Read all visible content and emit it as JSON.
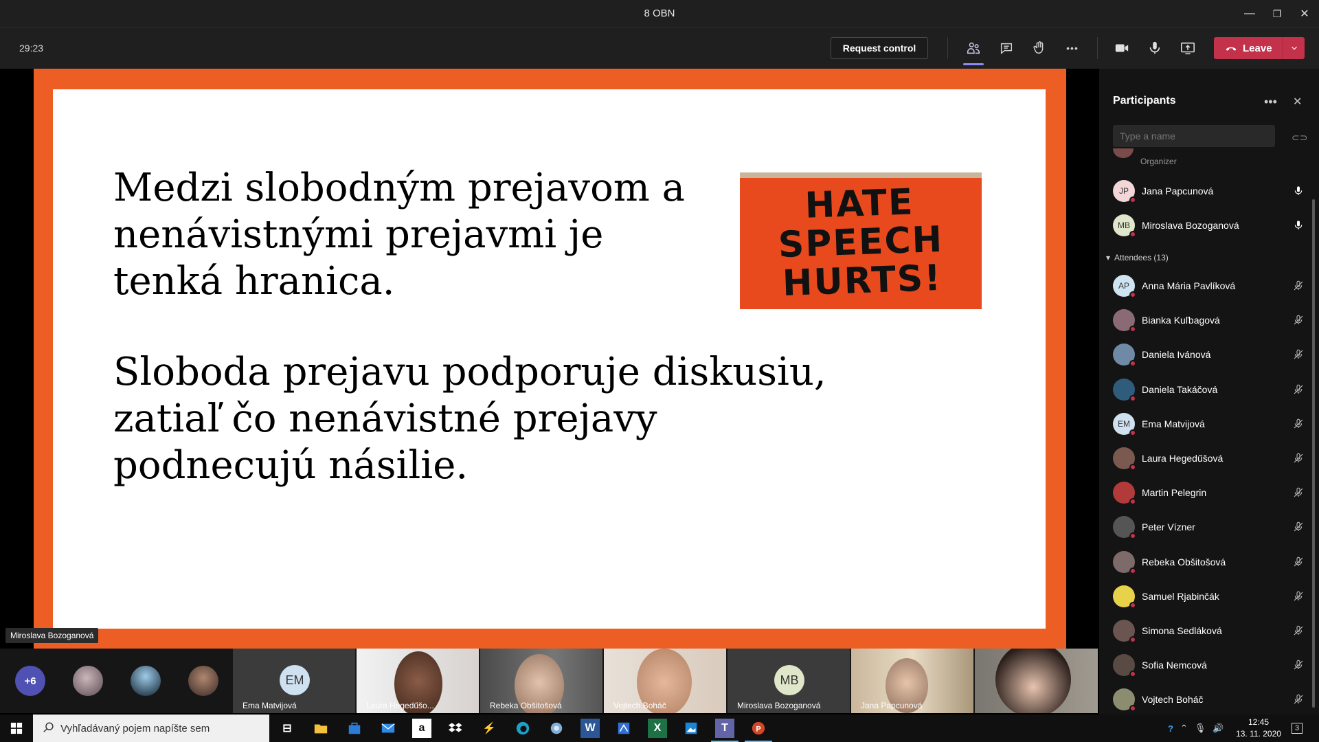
{
  "window": {
    "title": "8 OBN",
    "minimize": "—",
    "restore": "❐",
    "close": "✕"
  },
  "toolbar": {
    "timer": "29:23",
    "request_control": "Request control",
    "leave": "Leave",
    "more": "•••"
  },
  "slide": {
    "paragraph1": "Medzi slobodným prejavom a nenávistnými prejavmi je tenká hranica.",
    "paragraph2": "Sloboda prejavu podporuje diskusiu, zatiaľ čo nenávistné prejavy podnecujú násilie.",
    "sign_text": "HATE SPEECH HURTS!"
  },
  "presenter_tag": "Miroslava Bozoganová",
  "strip": {
    "overflow_count": "+6",
    "tiles": [
      {
        "name": "Ema Matvijová",
        "initials": "EM"
      },
      {
        "name": "Laura Hegedűšo...",
        "initials": ""
      },
      {
        "name": "Rebeka Obšitošová",
        "initials": ""
      },
      {
        "name": "Vojtech Boháč",
        "initials": ""
      },
      {
        "name": "Miroslava Bozoganová",
        "initials": "MB"
      },
      {
        "name": "Jana Papcunová",
        "initials": ""
      }
    ]
  },
  "participants": {
    "title": "Participants",
    "more": "•••",
    "close": "✕",
    "search_placeholder": "Type a name",
    "organizer_label": "Organizer",
    "presenters": [
      {
        "name": "Jana Papcunová",
        "initials": "JP",
        "color": "#f3d6d8"
      },
      {
        "name": "Miroslava Bozoganová",
        "initials": "MB",
        "color": "#dfe6c9"
      }
    ],
    "attendees_header": "Attendees (13)",
    "attendees": [
      {
        "name": "Anna Mária Pavlíková",
        "initials": "AP",
        "color": "#cfe4f3"
      },
      {
        "name": "Bianka Kuľbagová",
        "initials": "",
        "color": "#8a6a74"
      },
      {
        "name": "Daniela Ivánová",
        "initials": "",
        "color": "#6f8aa6"
      },
      {
        "name": "Daniela Takáčová",
        "initials": "",
        "color": "#2e5c7a"
      },
      {
        "name": "Ema Matvijová",
        "initials": "EM",
        "color": "#cfe0f0"
      },
      {
        "name": "Laura Hegedűšová",
        "initials": "",
        "color": "#7a5a50"
      },
      {
        "name": "Martin Pelegrin",
        "initials": "",
        "color": "#b33a3a"
      },
      {
        "name": "Peter Vízner",
        "initials": "",
        "color": "#555555"
      },
      {
        "name": "Rebeka Obšitošová",
        "initials": "",
        "color": "#7d6a6a"
      },
      {
        "name": "Samuel Rjabinčák",
        "initials": "",
        "color": "#e8d24a"
      },
      {
        "name": "Simona Sedláková",
        "initials": "",
        "color": "#6a5550"
      },
      {
        "name": "Sofia Nemcová",
        "initials": "",
        "color": "#5a4a44"
      },
      {
        "name": "Vojtech Boháč",
        "initials": "",
        "color": "#8c8c70"
      }
    ]
  },
  "taskbar": {
    "search_placeholder": "Vyhľadávaný pojem napíšte sem",
    "time": "12:45",
    "date": "13. 11. 2020",
    "notifications": "3"
  },
  "colors": {
    "accent": "#ec5e24",
    "leave": "#c4314b",
    "teams": "#6264a7"
  }
}
